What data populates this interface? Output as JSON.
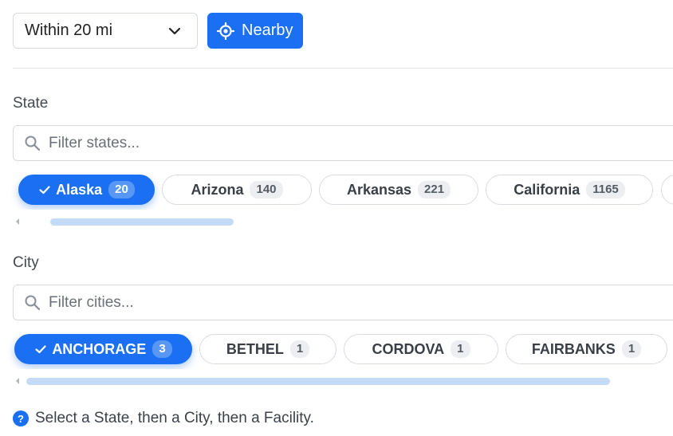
{
  "distance": {
    "selected": "Within 20 mi"
  },
  "nearby_button": {
    "label": "Nearby"
  },
  "state": {
    "label": "State",
    "filter_placeholder": "Filter states...",
    "chips": [
      {
        "name": "Alaska",
        "count": "20",
        "selected": true
      },
      {
        "name": "Arizona",
        "count": "140",
        "selected": false
      },
      {
        "name": "Arkansas",
        "count": "221",
        "selected": false
      },
      {
        "name": "California",
        "count": "1165",
        "selected": false
      }
    ]
  },
  "city": {
    "label": "City",
    "filter_placeholder": "Filter cities...",
    "chips": [
      {
        "name": "ANCHORAGE",
        "count": "3",
        "selected": true
      },
      {
        "name": "BETHEL",
        "count": "1",
        "selected": false
      },
      {
        "name": "CORDOVA",
        "count": "1",
        "selected": false
      },
      {
        "name": "FAIRBANKS",
        "count": "1",
        "selected": false
      }
    ]
  },
  "hint": {
    "icon": "question-icon",
    "text": "Select a State, then a City, then a Facility."
  },
  "colors": {
    "accent": "#1a6ff2",
    "border": "#d6d9de",
    "scroll_thumb": "#c3dbf7"
  }
}
